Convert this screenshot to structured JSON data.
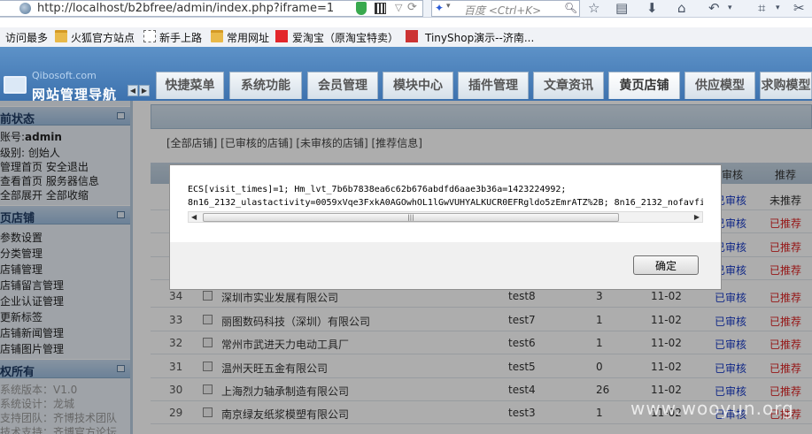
{
  "browser": {
    "url": "http://localhost/b2bfree/admin/index.php?iframe=1",
    "search_placeholder": "百度 <Ctrl+K>"
  },
  "bookmarks": [
    "访问最多",
    "火狐官方站点",
    "新手上路",
    "常用网址",
    "爱淘宝（原淘宝特卖）",
    "TinyShop演示--济南..."
  ],
  "header": {
    "logo_small": "Qibosoft.com",
    "logo": "网站管理导航",
    "nav_prev": "◀",
    "nav_next": "▶",
    "tabs": [
      "快捷菜单",
      "系统功能",
      "会员管理",
      "模块中心",
      "插件管理",
      "文章资讯",
      "黄页店铺",
      "供应模型",
      "求购模型"
    ]
  },
  "sidebar": {
    "status_title": "前状态",
    "account_label": "账号:",
    "account_value": "admin",
    "level_label": "级别:",
    "level_value": "创始人",
    "links1": "管理首页  安全退出",
    "links2": "查看首页  服务器信息",
    "links3": "全部展开  全部收缩",
    "shop_title": "页店铺",
    "shop_items": [
      "参数设置",
      "分类管理",
      "店铺管理",
      "店铺留言管理",
      "企业认证管理",
      "更新标签",
      "店铺新闻管理",
      "店铺图片管理"
    ],
    "copyright_title": "权所有",
    "copyright_lines": [
      "系统版本：V1.0",
      "系统设计：龙城",
      "支持团队：齐博技术团队",
      "技术支持：齐博官方论坛"
    ]
  },
  "main": {
    "filters": "[全部店铺] [已审核的店铺] [未审核的店铺] [推荐信息]",
    "header_audit": "审核",
    "header_recommend": "推荐",
    "rows": [
      {
        "id": "34",
        "name": "深圳市实业发展有限公司",
        "user": "test8",
        "count": "3",
        "date": "11-02",
        "audit": "已审核",
        "rec": "已推荐"
      },
      {
        "id": "33",
        "name": "丽图数码科技（深圳）有限公司",
        "user": "test7",
        "count": "1",
        "date": "11-02",
        "audit": "已审核",
        "rec": "已推荐"
      },
      {
        "id": "32",
        "name": "常州市武进天力电动工具厂",
        "user": "test6",
        "count": "1",
        "date": "11-02",
        "audit": "已审核",
        "rec": "已推荐"
      },
      {
        "id": "31",
        "name": "温州天旺五金有限公司",
        "user": "test5",
        "count": "0",
        "date": "11-02",
        "audit": "已审核",
        "rec": "已推荐"
      },
      {
        "id": "30",
        "name": "上海烈力轴承制造有限公司",
        "user": "test4",
        "count": "26",
        "date": "11-02",
        "audit": "已审核",
        "rec": "已推荐"
      },
      {
        "id": "29",
        "name": "南京绿友纸浆模塑有限公司",
        "user": "test3",
        "count": "1",
        "date": "11-02",
        "audit": "已审核",
        "rec": "已推荐"
      }
    ],
    "upper_right": [
      {
        "audit": "已审核",
        "rec": "未推荐"
      },
      {
        "audit": "已审核",
        "rec": "已推荐"
      },
      {
        "audit": "已审核",
        "rec": "已推荐"
      },
      {
        "audit": "已审核",
        "rec": "已推荐"
      }
    ]
  },
  "dialog": {
    "line1": "ECS[visit_times]=1; Hm_lvt_7b6b7838ea6c62b676abdfd6aae3b36a=1423224992;",
    "line2": "8n16_2132_ulastactivity=0059xVqe3FxkA0AGOwhOL1lGwVUHYALKUCR0EFRgldo5zEmrATZ%2B; 8n16_2132_nofavfi",
    "scroll_left": "◀",
    "scroll_right": "▶",
    "scroll_grip": "|||",
    "ok_label": "确定"
  },
  "watermark": "www.wooyun.org"
}
